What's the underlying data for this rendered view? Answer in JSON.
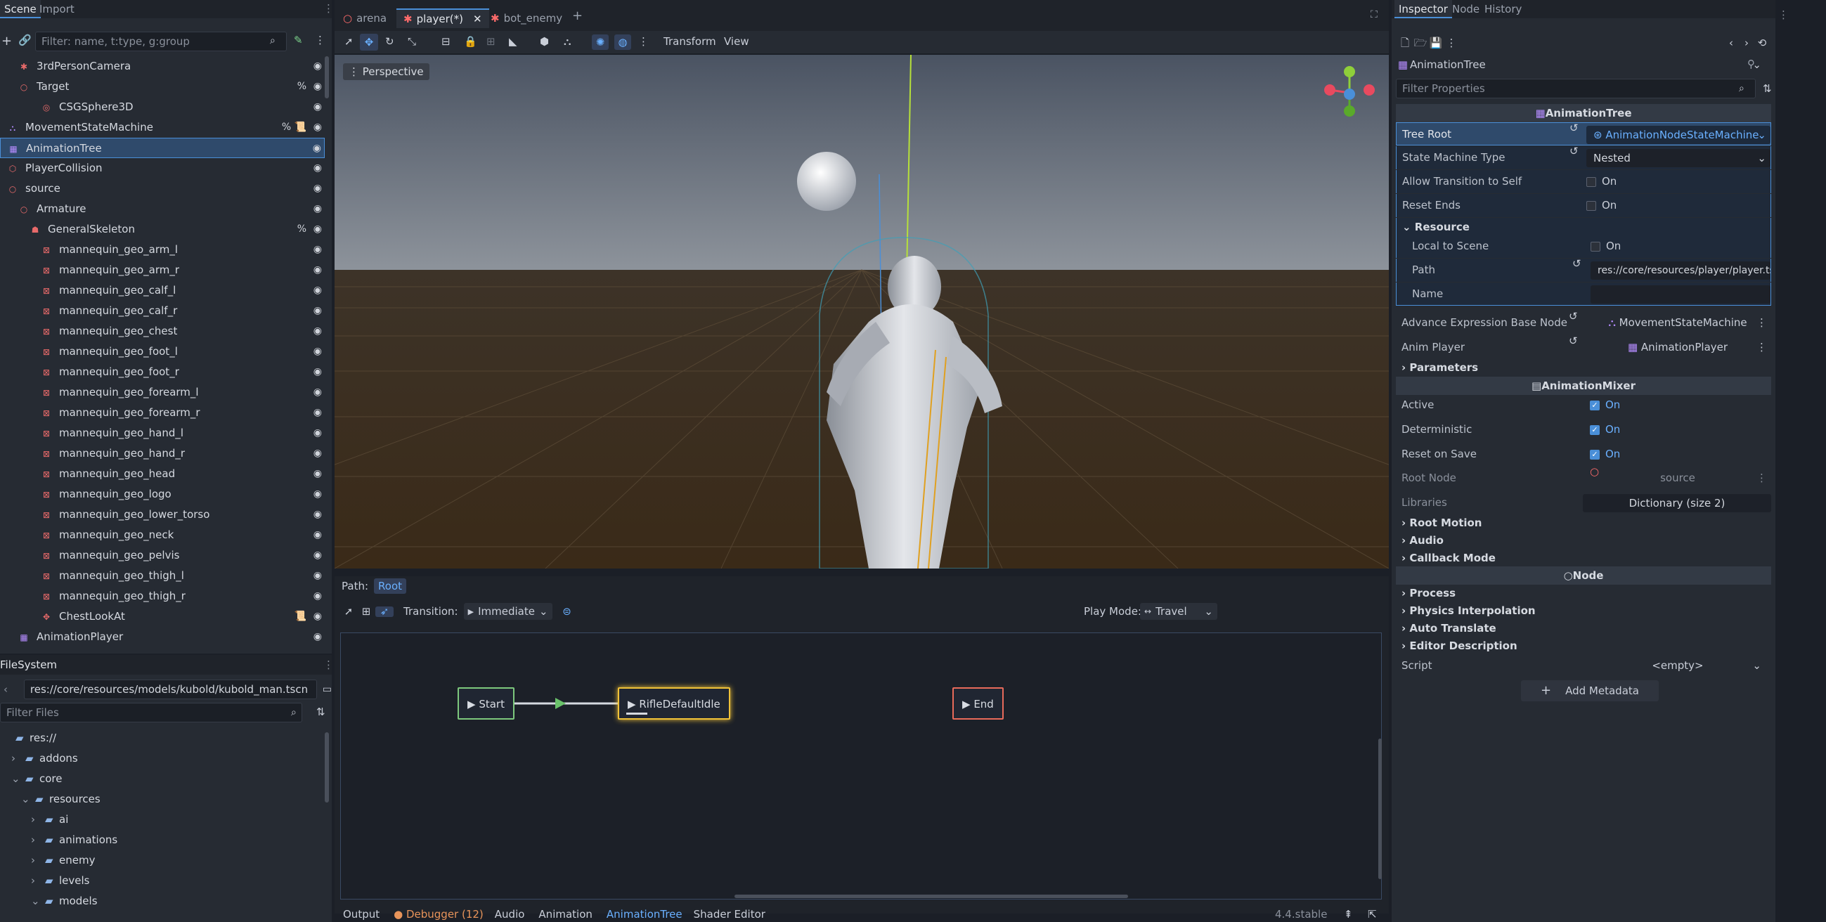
{
  "scene_panel": {
    "tabs": [
      "Scene",
      "Import"
    ],
    "filter_placeholder": "Filter: name, t:type, g:group",
    "tree": [
      {
        "label": "3rdPersonCamera",
        "depth": 1,
        "icon": "camera-icon",
        "color": "#e86a6a",
        "badges": []
      },
      {
        "label": "Target",
        "depth": 1,
        "icon": "node3d-icon",
        "color": "#e86a6a",
        "badges": [
          "%"
        ]
      },
      {
        "label": "CSGSphere3D",
        "depth": 3,
        "icon": "csg-sphere-icon",
        "color": "#e86a6a",
        "badges": []
      },
      {
        "label": "MovementStateMachine",
        "depth": 0,
        "icon": "state-machine-icon",
        "color": "#b58cff",
        "badges": [
          "%",
          "script"
        ]
      },
      {
        "label": "AnimationTree",
        "depth": 0,
        "icon": "animation-tree-icon",
        "color": "#b58cff",
        "badges": [],
        "selected": true
      },
      {
        "label": "PlayerCollision",
        "depth": 0,
        "icon": "collision-icon",
        "color": "#e86a6a",
        "badges": []
      },
      {
        "label": "source",
        "depth": 0,
        "icon": "node3d-icon",
        "color": "#e86a6a",
        "badges": []
      },
      {
        "label": "Armature",
        "depth": 1,
        "icon": "node3d-icon",
        "color": "#e86a6a",
        "badges": []
      },
      {
        "label": "GeneralSkeleton",
        "depth": 2,
        "icon": "skeleton-icon",
        "color": "#e86a6a",
        "badges": [
          "%"
        ]
      },
      {
        "label": "mannequin_geo_arm_l",
        "depth": 3,
        "icon": "mesh-icon",
        "color": "#e86a6a",
        "badges": []
      },
      {
        "label": "mannequin_geo_arm_r",
        "depth": 3,
        "icon": "mesh-icon",
        "color": "#e86a6a",
        "badges": []
      },
      {
        "label": "mannequin_geo_calf_l",
        "depth": 3,
        "icon": "mesh-icon",
        "color": "#e86a6a",
        "badges": []
      },
      {
        "label": "mannequin_geo_calf_r",
        "depth": 3,
        "icon": "mesh-icon",
        "color": "#e86a6a",
        "badges": []
      },
      {
        "label": "mannequin_geo_chest",
        "depth": 3,
        "icon": "mesh-icon",
        "color": "#e86a6a",
        "badges": []
      },
      {
        "label": "mannequin_geo_foot_l",
        "depth": 3,
        "icon": "mesh-icon",
        "color": "#e86a6a",
        "badges": []
      },
      {
        "label": "mannequin_geo_foot_r",
        "depth": 3,
        "icon": "mesh-icon",
        "color": "#e86a6a",
        "badges": []
      },
      {
        "label": "mannequin_geo_forearm_l",
        "depth": 3,
        "icon": "mesh-icon",
        "color": "#e86a6a",
        "badges": []
      },
      {
        "label": "mannequin_geo_forearm_r",
        "depth": 3,
        "icon": "mesh-icon",
        "color": "#e86a6a",
        "badges": []
      },
      {
        "label": "mannequin_geo_hand_l",
        "depth": 3,
        "icon": "mesh-icon",
        "color": "#e86a6a",
        "badges": []
      },
      {
        "label": "mannequin_geo_hand_r",
        "depth": 3,
        "icon": "mesh-icon",
        "color": "#e86a6a",
        "badges": []
      },
      {
        "label": "mannequin_geo_head",
        "depth": 3,
        "icon": "mesh-icon",
        "color": "#e86a6a",
        "badges": []
      },
      {
        "label": "mannequin_geo_logo",
        "depth": 3,
        "icon": "mesh-icon",
        "color": "#e86a6a",
        "badges": []
      },
      {
        "label": "mannequin_geo_lower_torso",
        "depth": 3,
        "icon": "mesh-icon",
        "color": "#e86a6a",
        "badges": []
      },
      {
        "label": "mannequin_geo_neck",
        "depth": 3,
        "icon": "mesh-icon",
        "color": "#e86a6a",
        "badges": []
      },
      {
        "label": "mannequin_geo_pelvis",
        "depth": 3,
        "icon": "mesh-icon",
        "color": "#e86a6a",
        "badges": []
      },
      {
        "label": "mannequin_geo_thigh_l",
        "depth": 3,
        "icon": "mesh-icon",
        "color": "#e86a6a",
        "badges": []
      },
      {
        "label": "mannequin_geo_thigh_r",
        "depth": 3,
        "icon": "mesh-icon",
        "color": "#e86a6a",
        "badges": []
      },
      {
        "label": "ChestLookAt",
        "depth": 3,
        "icon": "look-at-icon",
        "color": "#e86a6a",
        "badges": [
          "script"
        ]
      },
      {
        "label": "AnimationPlayer",
        "depth": 1,
        "icon": "animation-player-icon",
        "color": "#b58cff",
        "badges": []
      }
    ]
  },
  "filesystem": {
    "title": "FileSystem",
    "path": "res://core/resources/models/kubold/kubold_man.tscn",
    "filter_placeholder": "Filter Files",
    "tree": [
      {
        "label": "res://",
        "depth": 0,
        "arrow": ""
      },
      {
        "label": "addons",
        "depth": 1,
        "arrow": "›"
      },
      {
        "label": "core",
        "depth": 1,
        "arrow": "⌄"
      },
      {
        "label": "resources",
        "depth": 2,
        "arrow": "⌄"
      },
      {
        "label": "ai",
        "depth": 3,
        "arrow": "›"
      },
      {
        "label": "animations",
        "depth": 3,
        "arrow": "›"
      },
      {
        "label": "enemy",
        "depth": 3,
        "arrow": "›"
      },
      {
        "label": "levels",
        "depth": 3,
        "arrow": "›"
      },
      {
        "label": "models",
        "depth": 3,
        "arrow": "⌄"
      }
    ]
  },
  "doc_tabs": [
    {
      "label": "arena",
      "active": false
    },
    {
      "label": "player(*)",
      "active": true
    },
    {
      "label": "bot_enemy",
      "active": false
    }
  ],
  "toolbar": {
    "transform": "Transform",
    "view": "View"
  },
  "viewport": {
    "perspective": "Perspective",
    "gizmo": {
      "x": "X",
      "y": "Y",
      "z": "Z"
    }
  },
  "anim_tree": {
    "path_label": "Path:",
    "path_root": "Root",
    "transition_label": "Transition:",
    "transition_value": "Immediate",
    "play_mode_label": "Play Mode:",
    "play_mode_value": "Travel",
    "nodes": {
      "start": "Start",
      "idle": "RifleDefaultIdle",
      "end": "End"
    }
  },
  "bottom_tabs": [
    "Output",
    "Debugger (12)",
    "Audio",
    "Animation",
    "AnimationTree",
    "Shader Editor"
  ],
  "version": "4.4.stable",
  "inspector": {
    "tabs": [
      "Inspector",
      "Node",
      "History"
    ],
    "object": "AnimationTree",
    "filter_placeholder": "Filter Properties",
    "cat_animation_tree": "AnimationTree",
    "tree_root_label": "Tree Root",
    "tree_root_value": "AnimationNodeStateMachine",
    "state_machine_type_label": "State Machine Type",
    "state_machine_type_value": "Nested",
    "allow_transition_label": "Allow Transition to Self",
    "reset_ends_label": "Reset Ends",
    "on": "On",
    "resource_section": "Resource",
    "local_to_scene_label": "Local to Scene",
    "path_label": "Path",
    "path_value": "res://core/resources/player/player.tsc",
    "name_label": "Name",
    "advance_label": "Advance Expression Base Node",
    "advance_value": "MovementStateMachine",
    "anim_player_label": "Anim Player",
    "anim_player_value": "AnimationPlayer",
    "parameters": "Parameters",
    "cat_mixer": "AnimationMixer",
    "active_label": "Active",
    "deterministic_label": "Deterministic",
    "reset_on_save_label": "Reset on Save",
    "root_node_label": "Root Node",
    "root_node_value": "source",
    "libraries_label": "Libraries",
    "libraries_value": "Dictionary (size 2)",
    "root_motion": "Root Motion",
    "audio": "Audio",
    "callback_mode": "Callback Mode",
    "cat_node": "Node",
    "process": "Process",
    "physics_interp": "Physics Interpolation",
    "auto_translate": "Auto Translate",
    "editor_desc": "Editor Description",
    "script_label": "Script",
    "script_value": "<empty>",
    "add_metadata": "Add Metadata"
  }
}
